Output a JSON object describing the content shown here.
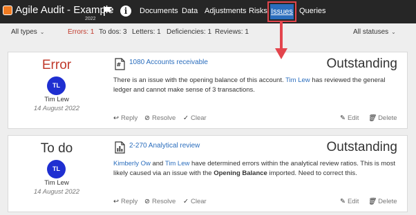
{
  "header": {
    "app_title": "Agile Audit - Example",
    "app_year": "2022",
    "nav": [
      "Documents",
      "Data",
      "Adjustments",
      "Risks"
    ],
    "active_nav": "Issues",
    "after_nav": [
      "Queries"
    ]
  },
  "filters": {
    "type_select": "All types",
    "errors": "Errors: 1",
    "todos": "To dos: 3",
    "letters": "Letters: 1",
    "deficiencies": "Deficiencies: 1",
    "reviews": "Reviews: 1",
    "status_select": "All statuses"
  },
  "issues": [
    {
      "kind": "Error",
      "initials": "TL",
      "author": "Tim Lew",
      "date": "14 August 2022",
      "doc_link": "1080 Accounts receivable",
      "status": "Outstanding",
      "text_1": "There is an issue with the opening balance of this account.",
      "mention_1": "Tim Lew",
      "text_2": "has reviewed the general ledger and cannot make sense of 3 transactions.",
      "reply": "Reply",
      "resolve": "Resolve",
      "clear": "Clear",
      "edit": "Edit",
      "delete": "Delete"
    },
    {
      "kind": "To do",
      "initials": "TL",
      "author": "Tim Lew",
      "date": "14 August 2022",
      "doc_link": "2-270 Analytical review",
      "status": "Outstanding",
      "mention_a": "Kimberly Ow",
      "text_and": "and",
      "mention_b": "Tim Lew",
      "text_1": "have determined errors within the analytical review ratios. This is most likely caused via an issue with the",
      "bold_text": "Opening Balance",
      "text_2": "imported. Need to correct this.",
      "reply": "Reply",
      "resolve": "Resolve",
      "clear": "Clear",
      "edit": "Edit",
      "delete": "Delete"
    }
  ],
  "colors": {
    "topbar": "#262626",
    "accent": "#2a6dbd",
    "error": "#c0392b",
    "highlight_border": "#e3454d",
    "avatar": "#1f2fd1"
  }
}
